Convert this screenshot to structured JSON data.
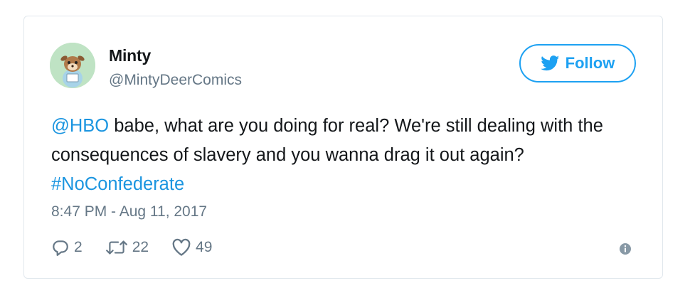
{
  "tweet": {
    "author_name": "Minty",
    "author_handle": "@MintyDeerComics",
    "follow_label": "Follow",
    "text_mention": "@HBO",
    "text_body": " babe, what are you doing for real? We're still dealing with the consequences of slavery and you wanna drag it out again? ",
    "text_hashtag": "#NoConfederate",
    "timestamp": "8:47 PM - Aug 11, 2017",
    "reply_count": "2",
    "retweet_count": "22",
    "like_count": "49"
  },
  "colors": {
    "brand_blue": "#1da1f2",
    "link_blue": "#1b95e0",
    "secondary_gray": "#657786",
    "avatar_bg": "#bfe3c4"
  },
  "icons": {
    "follow": "twitter-bird-icon",
    "reply": "reply-icon",
    "retweet": "retweet-icon",
    "like": "heart-icon",
    "info": "info-icon"
  }
}
